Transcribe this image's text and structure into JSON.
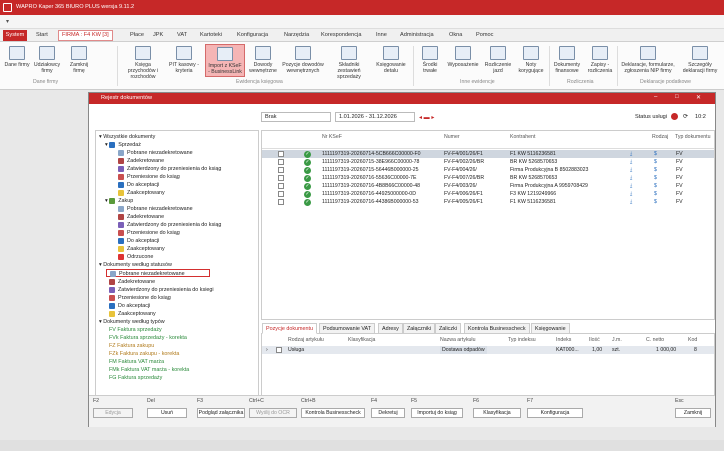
{
  "app": {
    "title": "WAPRO Kaper 365 BIURO PLUS wersja 9.11.2"
  },
  "menu": {
    "system": "System",
    "items": [
      "Start",
      "Płace",
      "JPK",
      "VAT",
      "Kartoteki",
      "Konfiguracja",
      "Narzędzia",
      "Korespondencja",
      "Inne",
      "Administracja",
      "Okna",
      "Pomoc"
    ],
    "firma": "FIRMA : F4 KW [3]"
  },
  "ribbon": {
    "buttons": [
      {
        "label": "Dane firmy"
      },
      {
        "label": "Udziałowcy firmy"
      },
      {
        "label": "Zamknij firmę"
      },
      {
        "label": "Księga przychodów i rozchodów"
      },
      {
        "label": "PIT kasowy - kryteria"
      },
      {
        "label": "Import z KSeF - BusinessLink"
      },
      {
        "label": "Dowody wewnętrzne"
      },
      {
        "label": "Pozycje dowodów wewnętrznych"
      },
      {
        "label": "Składniki zestawień sprzedaży"
      },
      {
        "label": "Księgowanie detalu"
      },
      {
        "label": "Środki trwałe"
      },
      {
        "label": "Wyposażenie"
      },
      {
        "label": "Rozliczenie jazd"
      },
      {
        "label": "Noty korygujące"
      },
      {
        "label": "Dokumenty finansowe"
      },
      {
        "label": "Zapisy - rozliczenia"
      },
      {
        "label": "Deklaracje, formularze, zgłoszenia NIP firmy"
      },
      {
        "label": "Szczegóły deklaracji firmy"
      }
    ],
    "groups": [
      "Dane firmy",
      "Ewidencja księgowa",
      "Inne ewidencje",
      "Rozliczenia",
      "Deklaracje podatkowe"
    ]
  },
  "window": {
    "title": "Rejestr dokumentów"
  },
  "toolbar": {
    "filter": "Brak",
    "period": "1.01.2026 - 31.12.2026",
    "status_label": "Status usługi",
    "time": "10:2"
  },
  "tree": {
    "root": "Wszystkie dokumenty",
    "sprzedaz": {
      "label": "Sprzedaż",
      "items": [
        "Pobrane niezadekretowane",
        "Zadekretowane",
        "Zatwierdzony do przeniesienia do ksiąg",
        "Przeniesione do ksiąg",
        "Do akceptacji",
        "Zaakceptowany"
      ]
    },
    "zakup": {
      "label": "Zakup",
      "items": [
        "Pobrane niezadekretowane",
        "Zadekretowane",
        "Zatwierdzony do przeniesienia do ksiąg",
        "Przeniesione do ksiąg",
        "Do akceptacji",
        "Zaakceptowany",
        "Odrzucone"
      ]
    },
    "statusy": {
      "label": "Dokumenty według statusów",
      "items": [
        "Pobrane niezadekretowane",
        "Zadekretowane",
        "Zatwierdzony do przeniesienia do ksiegi",
        "Przeniesione do ksiąg",
        "Do akceptacji",
        "Zaakceptowany"
      ]
    },
    "typy": {
      "label": "Dokumenty według typów",
      "items": [
        "FV Faktura sprzedaży",
        "FVk Faktura sprzedaży - korekta",
        "FZ Faktura zakupu",
        "FZk Faktura zakupu - korekta",
        "FM Faktura VAT marża",
        "FMk Faktura VAT marża - korekta",
        "FG Faktura sprzedaży"
      ]
    }
  },
  "grid": {
    "headers": [
      "Nr KSeF",
      "Numer",
      "Kontrahent",
      "Rodzaj",
      "Typ dokumentu"
    ],
    "rows": [
      {
        "ksef": "1111197319-20260714-5CB666C00000-F0",
        "numer": "FV-F4/001/26/F1",
        "kontrahent": "F1 KW 5116236581",
        "typ": "FV"
      },
      {
        "ksef": "1111197319-20260715-38E966C00000-78",
        "numer": "FV-F4/002/26/BR",
        "kontrahent": "BR KW 5268570653",
        "typ": "FV"
      },
      {
        "ksef": "1111197319-20260715-56446B000000-25",
        "numer": "FV-F4/004/26/",
        "kontrahent": "Firma Produkcyjna B 8502883023",
        "typ": "FV"
      },
      {
        "ksef": "1111197319-20260716-55636C00000-7E",
        "numer": "FV-F4/007/26/BR",
        "kontrahent": "BR KW 5268570653",
        "typ": "FV"
      },
      {
        "ksef": "1111197319-20260716-4B8B66C00000-48",
        "numer": "FV-F4/003/26/",
        "kontrahent": "Firma Produkcyjna A 9959708429",
        "typ": "FV"
      },
      {
        "ksef": "1111197319-20260716-44925000000-0D",
        "numer": "FV-F4/006/26/F1",
        "kontrahent": "F3 KW 1219249966",
        "typ": "FV"
      },
      {
        "ksef": "1111197319-20260716-44386B000000-53",
        "numer": "FV-F4/005/26/F1",
        "kontrahent": "F1 KW 5116236581",
        "typ": "FV"
      }
    ]
  },
  "tabs": [
    "Pozycje dokumentu",
    "Podsumowanie VAT",
    "Adresy",
    "Załączniki",
    "Zaliczki",
    "Kontrola Businesscheck",
    "Księgowanie"
  ],
  "positions": {
    "headers": [
      "Rodzaj artykułu",
      "Klasyfikacja",
      "Nazwa artykułu",
      "Typ indeksu",
      "Indeks",
      "Ilość",
      "J.m.",
      "C. netto",
      "Kod"
    ],
    "row": {
      "rodzaj": "Usługa",
      "nazwa": "Dostawa odpadów",
      "indeks": "KAT000...",
      "ilosc": "1,00",
      "jm": "szt.",
      "netto": "1 000,00",
      "kod": "8"
    }
  },
  "fkeys": [
    {
      "key": "F2",
      "label": "Edycja",
      "disabled": true
    },
    {
      "key": "Del",
      "label": "Usuń",
      "disabled": false
    },
    {
      "key": "F3",
      "label": "Podgląd załącznika",
      "disabled": false
    },
    {
      "key": "Ctrl+C",
      "label": "Wyślij do OCR",
      "disabled": true
    },
    {
      "key": "Ctrl+B",
      "label": "Kontrola Businesscheck",
      "disabled": false
    },
    {
      "key": "F4",
      "label": "Dekretuj",
      "disabled": false
    },
    {
      "key": "F5",
      "label": "Importuj do ksiąg",
      "disabled": false
    },
    {
      "key": "F6",
      "label": "Klasyfikacja",
      "disabled": false
    },
    {
      "key": "F7",
      "label": "Konfiguracja",
      "disabled": false
    },
    {
      "key": "Esc",
      "label": "Zamknij",
      "disabled": false
    }
  ],
  "colors": {
    "brand": "#c62828",
    "ok": "#3a9a45",
    "selected_row": "#cfd6df"
  }
}
